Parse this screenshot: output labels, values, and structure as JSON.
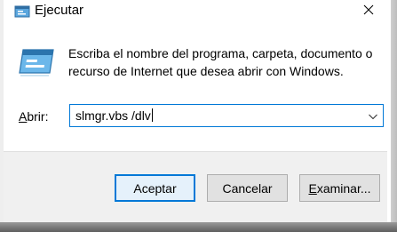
{
  "window": {
    "title": "Ejecutar",
    "title_icon": "run-icon",
    "close_icon": "close-icon"
  },
  "content": {
    "icon": "run-program-icon",
    "description": "Escriba el nombre del programa, carpeta, documento o recurso de Internet que desea abrir con Windows.",
    "open_label_mnemonic": "A",
    "open_label_rest": "brir:",
    "command_value": "slmgr.vbs /dlv",
    "dropdown_icon": "chevron-down-icon"
  },
  "buttons": {
    "accept": "Aceptar",
    "cancel": "Cancelar",
    "browse_mnemonic": "E",
    "browse_rest": "xaminar..."
  },
  "colors": {
    "accent": "#0078d7",
    "footer_bg": "#f0f0f0",
    "button_bg": "#e1e1e1"
  }
}
